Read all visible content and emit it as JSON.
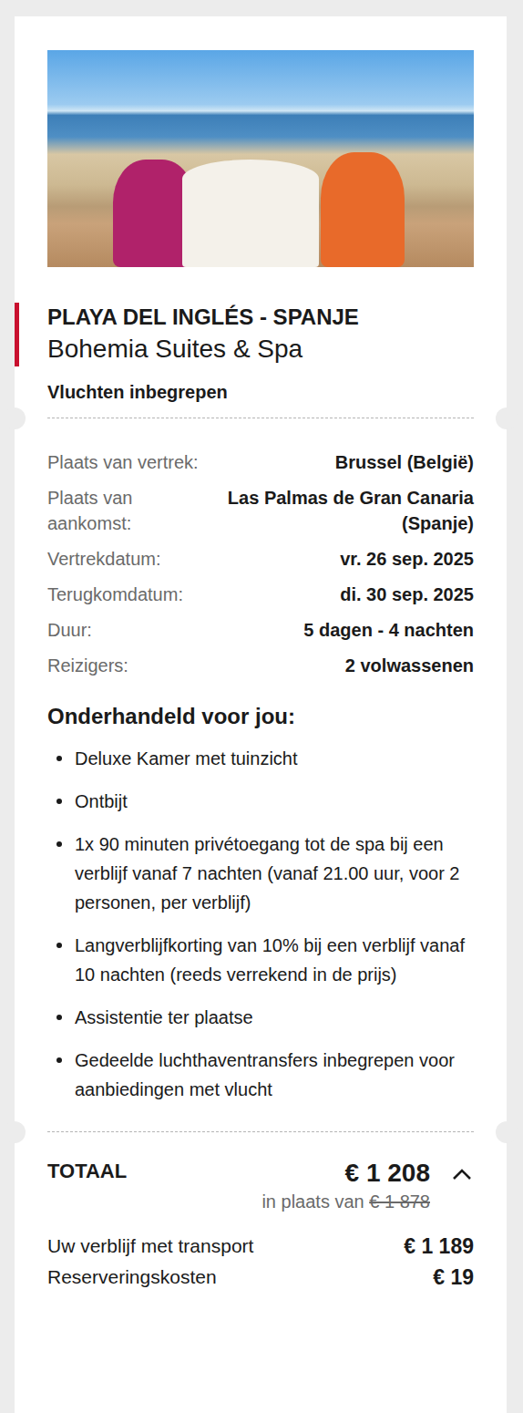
{
  "hotel": {
    "location": "PLAYA DEL INGLÉS - SPANJE",
    "name": "Bohemia Suites & Spa",
    "flights_note": "Vluchten inbegrepen"
  },
  "details": [
    {
      "label": "Plaats van vertrek:",
      "value": "Brussel (België)"
    },
    {
      "label": "Plaats van aankomst:",
      "value": "Las Palmas de Gran Canaria (Spanje)"
    },
    {
      "label": "Vertrekdatum:",
      "value": "vr. 26 sep. 2025"
    },
    {
      "label": "Terugkomdatum:",
      "value": "di. 30 sep. 2025"
    },
    {
      "label": "Duur:",
      "value": "5 dagen - 4 nachten"
    },
    {
      "label": "Reizigers:",
      "value": "2 volwassenen"
    }
  ],
  "perks": {
    "title": "Onderhandeld voor jou:",
    "items": [
      "Deluxe Kamer met tuinzicht",
      "Ontbijt",
      "1x 90 minuten privétoegang tot de spa bij een verblijf vanaf 7 nachten (vanaf 21.00 uur, voor 2 personen, per verblijf)",
      "Langverblijfkorting van 10% bij een verblijf vanaf 10 nachten (reeds verrekend in de prijs)",
      "Assistentie ter plaatse",
      "Gedeelde luchthaventransfers inbegrepen voor aanbiedingen met vlucht"
    ]
  },
  "total": {
    "label": "TOTAAL",
    "price": "€ 1 208",
    "expanded": true,
    "was_prefix": "in plaats van",
    "was_price": "€ 1 878",
    "lines": [
      {
        "label": "Uw verblijf met transport",
        "value": "€ 1 189"
      },
      {
        "label": "Reserveringskosten",
        "value": "€ 19"
      }
    ]
  }
}
